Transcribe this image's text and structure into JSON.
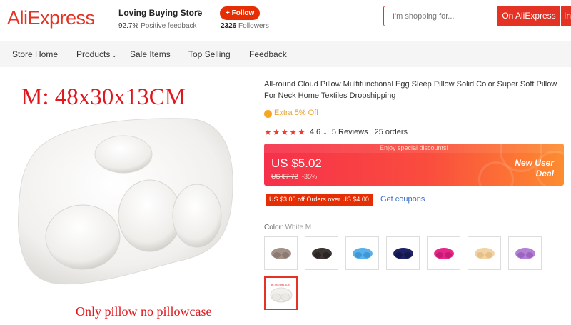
{
  "header": {
    "logo": "AliExpress",
    "store_name": "Loving Buying Store",
    "feedback_value": "92.7%",
    "feedback_label": "Positive feedback",
    "follow_label": "+ Follow",
    "followers_count": "2326",
    "followers_label": "Followers",
    "search_placeholder": "I'm shopping for...",
    "search_button": "On AliExpress",
    "search_button2": "In"
  },
  "nav": {
    "items": [
      "Store Home",
      "Products",
      "Sale Items",
      "Top Selling",
      "Feedback"
    ]
  },
  "product_image": {
    "size_text": "M: 48x30x13CM",
    "caption": "Only pillow no pillowcase"
  },
  "product": {
    "title": "All-round Cloud Pillow Multifunctional Egg Sleep Pillow Solid Color Super Soft Pillow For Neck Home Textiles Dropshipping",
    "extra_discount": "Extra 5% Off",
    "rating": "4.6",
    "rating_stars": 5,
    "reviews": "5 Reviews",
    "orders": "25 orders",
    "banner_top": "Enjoy special discounts!",
    "price": "US $5.02",
    "old_price": "US $7.72",
    "discount": "-35%",
    "new_user_line1": "New User",
    "new_user_line2": "Deal",
    "coupon_text": "US $3.00 off Orders over US $4.00",
    "get_coupons": "Get coupons",
    "color_label": "Color:",
    "color_value": "White M"
  },
  "colors": {
    "brand_red": "#e43225",
    "swatches": [
      "#a39188",
      "#3c3533",
      "#5ab0ea",
      "#1e2266",
      "#e6268a",
      "#f3d3a3",
      "#b57fd6",
      "#f2f0ed"
    ]
  }
}
